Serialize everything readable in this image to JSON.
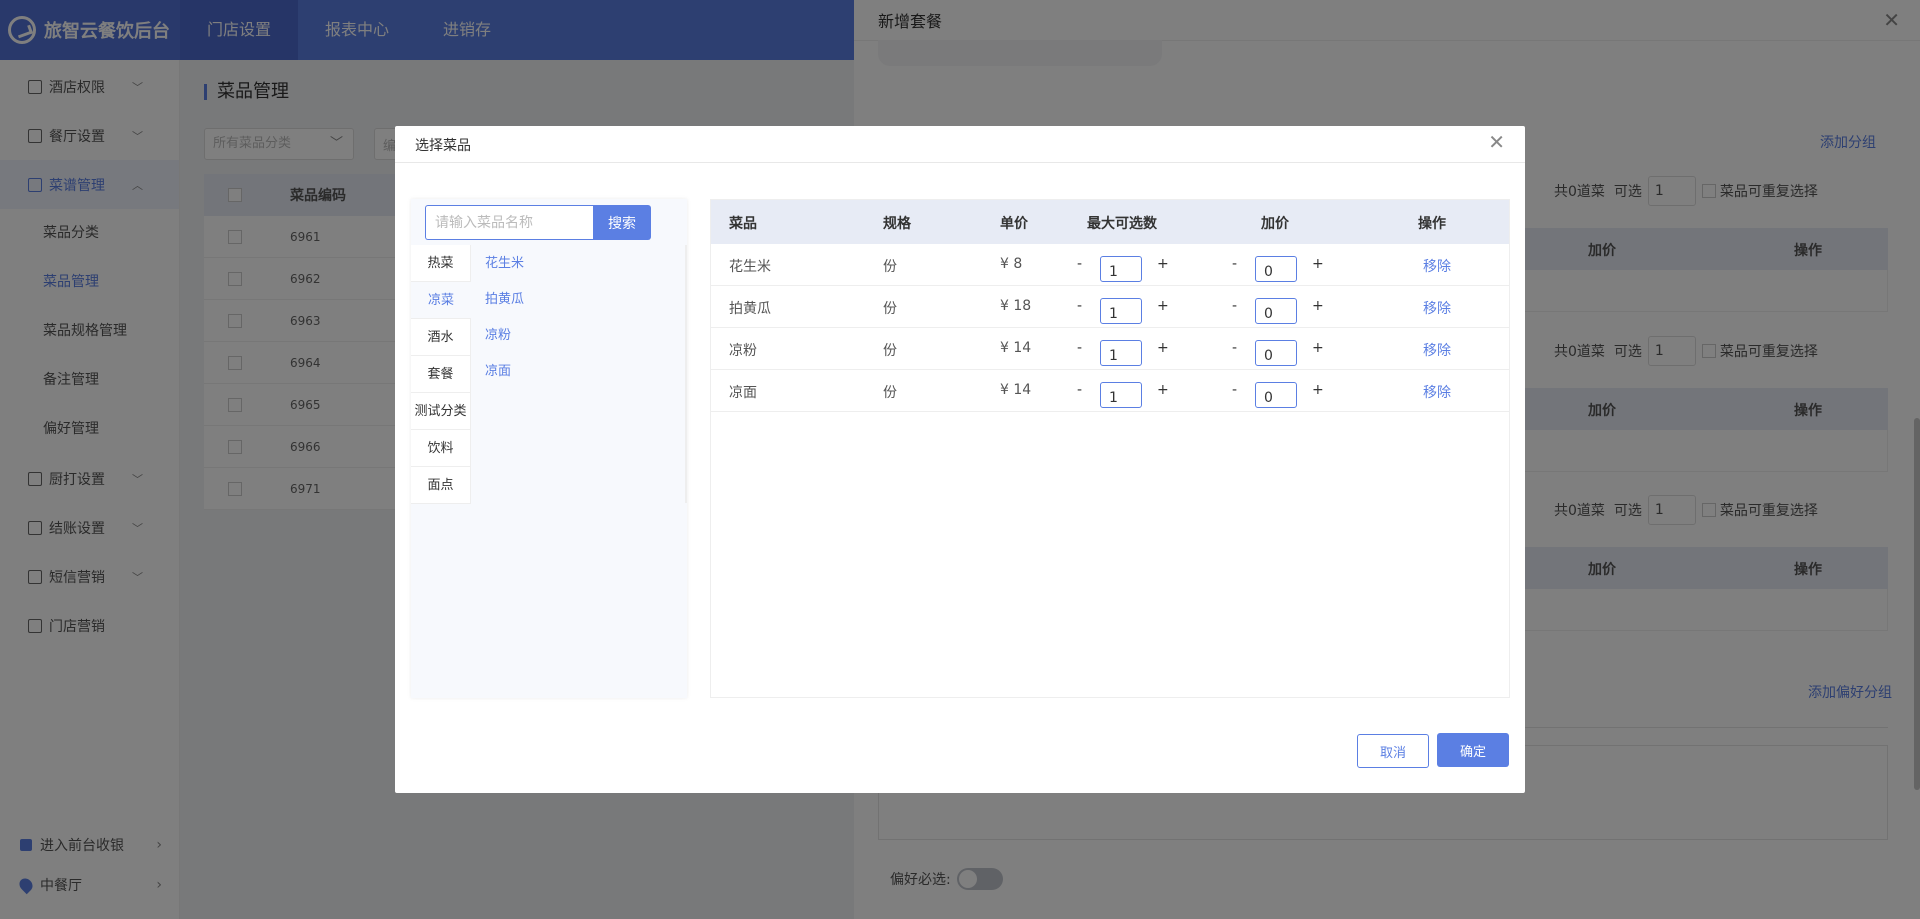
{
  "app": {
    "brand": "旅智云餐饮后台"
  },
  "topnav": [
    "门店设置",
    "报表中心",
    "进销存"
  ],
  "sidebar": {
    "items": [
      {
        "label": "酒店权限"
      },
      {
        "label": "餐厅设置"
      },
      {
        "label": "菜谱管理"
      }
    ],
    "subitems": [
      "菜品分类",
      "菜品管理",
      "菜品规格管理",
      "备注管理",
      "偏好管理"
    ],
    "items_after": [
      {
        "label": "厨打设置"
      },
      {
        "label": "结账设置"
      },
      {
        "label": "短信营销"
      },
      {
        "label": "门店营销"
      }
    ],
    "bottom": [
      "进入前台收银",
      "中餐厅"
    ]
  },
  "main": {
    "title": "菜品管理",
    "filter_placeholder": "所有菜品分类",
    "filter2_placeholder": "编",
    "table_header": "菜品编码",
    "codes": [
      "6961",
      "6962",
      "6963",
      "6964",
      "6965",
      "6966",
      "6971"
    ]
  },
  "drawer": {
    "title": "新增套餐",
    "add_group": "添加分组",
    "add_pref_group": "添加偏好分组",
    "group_total": "共0道菜",
    "group_optional": "可选",
    "group_optional_value": "1",
    "group_repeat": "菜品可重复选择",
    "col_price": "加价",
    "col_action": "操作",
    "pref_required": "偏好必选:"
  },
  "modal": {
    "title": "选择菜品",
    "search_placeholder": "请输入菜品名称",
    "search_btn": "搜索",
    "categories": [
      "热菜",
      "凉菜",
      "酒水",
      "套餐",
      "测试分类",
      "饮料",
      "面点"
    ],
    "active_category": "凉菜",
    "dishes": [
      "花生米",
      "拍黄瓜",
      "凉粉",
      "凉面"
    ],
    "columns": [
      "菜品",
      "规格",
      "单价",
      "最大可选数",
      "加价",
      "操作"
    ],
    "rows": [
      {
        "name": "花生米",
        "spec": "份",
        "price": "¥ 8",
        "max": "1",
        "extra": "0",
        "action": "移除"
      },
      {
        "name": "拍黄瓜",
        "spec": "份",
        "price": "¥ 18",
        "max": "1",
        "extra": "0",
        "action": "移除"
      },
      {
        "name": "凉粉",
        "spec": "份",
        "price": "¥ 14",
        "max": "1",
        "extra": "0",
        "action": "移除"
      },
      {
        "name": "凉面",
        "spec": "份",
        "price": "¥ 14",
        "max": "1",
        "extra": "0",
        "action": "移除"
      }
    ],
    "minus": "-",
    "plus": "+",
    "cancel": "取消",
    "ok": "确定"
  },
  "colors": {
    "accent": "#5b7fe3",
    "topbar": "#5b7fe3",
    "header_bg": "#e7ebf5"
  }
}
